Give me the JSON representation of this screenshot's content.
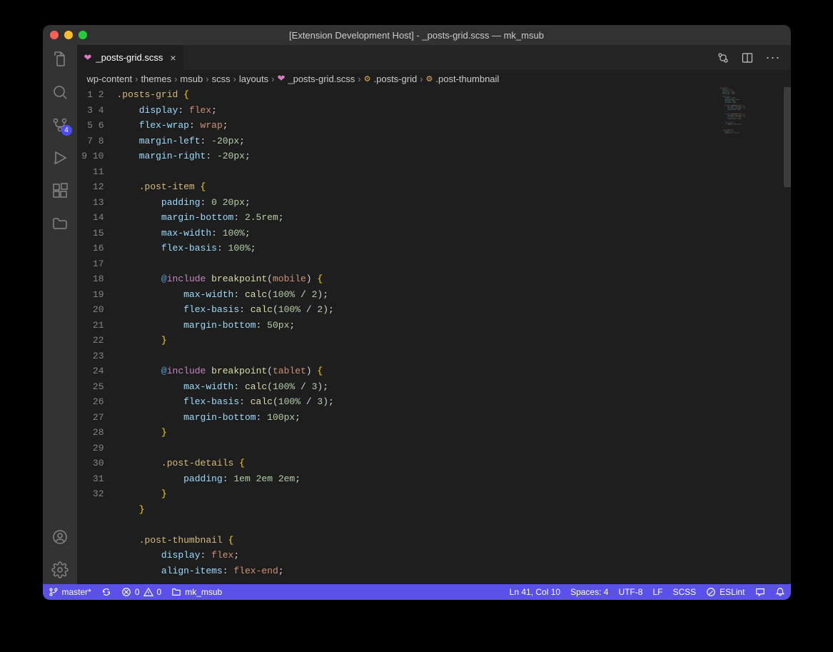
{
  "window_title": "[Extension Development Host] - _posts-grid.scss — mk_msub",
  "activity": {
    "scm_badge": "4"
  },
  "tab": {
    "filename": "_posts-grid.scss"
  },
  "breadcrumbs": {
    "items": [
      "wp-content",
      "themes",
      "msub",
      "scss",
      "layouts",
      "_posts-grid.scss",
      ".posts-grid",
      ".post-thumbnail"
    ]
  },
  "code_lines": [
    [
      [
        "sel",
        ".posts-grid"
      ],
      [
        "sp",
        " "
      ],
      [
        "brace",
        "{"
      ]
    ],
    [
      [
        "indent",
        1
      ],
      [
        "prop",
        "display"
      ],
      [
        "punc",
        ": "
      ],
      [
        "val",
        "flex"
      ],
      [
        "punc",
        ";"
      ]
    ],
    [
      [
        "indent",
        1
      ],
      [
        "prop",
        "flex-wrap"
      ],
      [
        "punc",
        ": "
      ],
      [
        "val",
        "wrap"
      ],
      [
        "punc",
        ";"
      ]
    ],
    [
      [
        "indent",
        1
      ],
      [
        "prop",
        "margin-left"
      ],
      [
        "punc",
        ": "
      ],
      [
        "num",
        "-20"
      ],
      [
        "unit",
        "px"
      ],
      [
        "punc",
        ";"
      ]
    ],
    [
      [
        "indent",
        1
      ],
      [
        "prop",
        "margin-right"
      ],
      [
        "punc",
        ": "
      ],
      [
        "num",
        "-20"
      ],
      [
        "unit",
        "px"
      ],
      [
        "punc",
        ";"
      ]
    ],
    [
      [
        "indent",
        0
      ]
    ],
    [
      [
        "indent",
        1
      ],
      [
        "sel",
        ".post-item"
      ],
      [
        "sp",
        " "
      ],
      [
        "brace",
        "{"
      ]
    ],
    [
      [
        "indent",
        2
      ],
      [
        "prop",
        "padding"
      ],
      [
        "punc",
        ": "
      ],
      [
        "num",
        "0 20"
      ],
      [
        "unit",
        "px"
      ],
      [
        "punc",
        ";"
      ]
    ],
    [
      [
        "indent",
        2
      ],
      [
        "prop",
        "margin-bottom"
      ],
      [
        "punc",
        ": "
      ],
      [
        "num",
        "2.5"
      ],
      [
        "unit",
        "rem"
      ],
      [
        "punc",
        ";"
      ]
    ],
    [
      [
        "indent",
        2
      ],
      [
        "prop",
        "max-width"
      ],
      [
        "punc",
        ": "
      ],
      [
        "num",
        "100"
      ],
      [
        "unit",
        "%"
      ],
      [
        "punc",
        ";"
      ]
    ],
    [
      [
        "indent",
        2
      ],
      [
        "prop",
        "flex-basis"
      ],
      [
        "punc",
        ": "
      ],
      [
        "num",
        "100"
      ],
      [
        "unit",
        "%"
      ],
      [
        "punc",
        ";"
      ]
    ],
    [
      [
        "indent",
        0
      ]
    ],
    [
      [
        "indent",
        2
      ],
      [
        "at",
        "@"
      ],
      [
        "kw",
        "include"
      ],
      [
        "sp",
        " "
      ],
      [
        "fn",
        "breakpoint"
      ],
      [
        "punc",
        "("
      ],
      [
        "val",
        "mobile"
      ],
      [
        "punc",
        ") "
      ],
      [
        "brace",
        "{"
      ]
    ],
    [
      [
        "indent",
        3
      ],
      [
        "prop",
        "max-width"
      ],
      [
        "punc",
        ": "
      ],
      [
        "fn",
        "calc"
      ],
      [
        "punc",
        "("
      ],
      [
        "num",
        "100"
      ],
      [
        "unit",
        "%"
      ],
      [
        "punc",
        " / "
      ],
      [
        "num",
        "2"
      ],
      [
        "punc",
        ")"
      ],
      [
        "punc",
        ";"
      ]
    ],
    [
      [
        "indent",
        3
      ],
      [
        "prop",
        "flex-basis"
      ],
      [
        "punc",
        ": "
      ],
      [
        "fn",
        "calc"
      ],
      [
        "punc",
        "("
      ],
      [
        "num",
        "100"
      ],
      [
        "unit",
        "%"
      ],
      [
        "punc",
        " / "
      ],
      [
        "num",
        "2"
      ],
      [
        "punc",
        ")"
      ],
      [
        "punc",
        ";"
      ]
    ],
    [
      [
        "indent",
        3
      ],
      [
        "prop",
        "margin-bottom"
      ],
      [
        "punc",
        ": "
      ],
      [
        "num",
        "50"
      ],
      [
        "unit",
        "px"
      ],
      [
        "punc",
        ";"
      ]
    ],
    [
      [
        "indent",
        2
      ],
      [
        "brace",
        "}"
      ]
    ],
    [
      [
        "indent",
        0
      ]
    ],
    [
      [
        "indent",
        2
      ],
      [
        "at",
        "@"
      ],
      [
        "kw",
        "include"
      ],
      [
        "sp",
        " "
      ],
      [
        "fn",
        "breakpoint"
      ],
      [
        "punc",
        "("
      ],
      [
        "val",
        "tablet"
      ],
      [
        "punc",
        ") "
      ],
      [
        "brace",
        "{"
      ]
    ],
    [
      [
        "indent",
        3
      ],
      [
        "prop",
        "max-width"
      ],
      [
        "punc",
        ": "
      ],
      [
        "fn",
        "calc"
      ],
      [
        "punc",
        "("
      ],
      [
        "num",
        "100"
      ],
      [
        "unit",
        "%"
      ],
      [
        "punc",
        " / "
      ],
      [
        "num",
        "3"
      ],
      [
        "punc",
        ")"
      ],
      [
        "punc",
        ";"
      ]
    ],
    [
      [
        "indent",
        3
      ],
      [
        "prop",
        "flex-basis"
      ],
      [
        "punc",
        ": "
      ],
      [
        "fn",
        "calc"
      ],
      [
        "punc",
        "("
      ],
      [
        "num",
        "100"
      ],
      [
        "unit",
        "%"
      ],
      [
        "punc",
        " / "
      ],
      [
        "num",
        "3"
      ],
      [
        "punc",
        ")"
      ],
      [
        "punc",
        ";"
      ]
    ],
    [
      [
        "indent",
        3
      ],
      [
        "prop",
        "margin-bottom"
      ],
      [
        "punc",
        ": "
      ],
      [
        "num",
        "100"
      ],
      [
        "unit",
        "px"
      ],
      [
        "punc",
        ";"
      ]
    ],
    [
      [
        "indent",
        2
      ],
      [
        "brace",
        "}"
      ]
    ],
    [
      [
        "indent",
        0
      ]
    ],
    [
      [
        "indent",
        2
      ],
      [
        "sel",
        ".post-details"
      ],
      [
        "sp",
        " "
      ],
      [
        "brace",
        "{"
      ]
    ],
    [
      [
        "indent",
        3
      ],
      [
        "prop",
        "padding"
      ],
      [
        "punc",
        ": "
      ],
      [
        "num",
        "1"
      ],
      [
        "unit",
        "em"
      ],
      [
        "sp",
        " "
      ],
      [
        "num",
        "2"
      ],
      [
        "unit",
        "em"
      ],
      [
        "sp",
        " "
      ],
      [
        "num",
        "2"
      ],
      [
        "unit",
        "em"
      ],
      [
        "punc",
        ";"
      ]
    ],
    [
      [
        "indent",
        2
      ],
      [
        "brace",
        "}"
      ]
    ],
    [
      [
        "indent",
        1
      ],
      [
        "brace",
        "}"
      ]
    ],
    [
      [
        "indent",
        0
      ]
    ],
    [
      [
        "indent",
        1
      ],
      [
        "sel",
        ".post-thumbnail"
      ],
      [
        "sp",
        " "
      ],
      [
        "brace",
        "{"
      ]
    ],
    [
      [
        "indent",
        2
      ],
      [
        "prop",
        "display"
      ],
      [
        "punc",
        ": "
      ],
      [
        "val",
        "flex"
      ],
      [
        "punc",
        ";"
      ]
    ],
    [
      [
        "indent",
        2
      ],
      [
        "prop",
        "align-items"
      ],
      [
        "punc",
        ": "
      ],
      [
        "val",
        "flex-end"
      ],
      [
        "punc",
        ";"
      ]
    ]
  ],
  "statusbar": {
    "branch": "master*",
    "errors": "0",
    "warnings": "0",
    "folder": "mk_msub",
    "cursor": "Ln 41, Col 10",
    "spaces": "Spaces: 4",
    "encoding": "UTF-8",
    "eol": "LF",
    "lang": "SCSS",
    "eslint": "ESLint"
  }
}
